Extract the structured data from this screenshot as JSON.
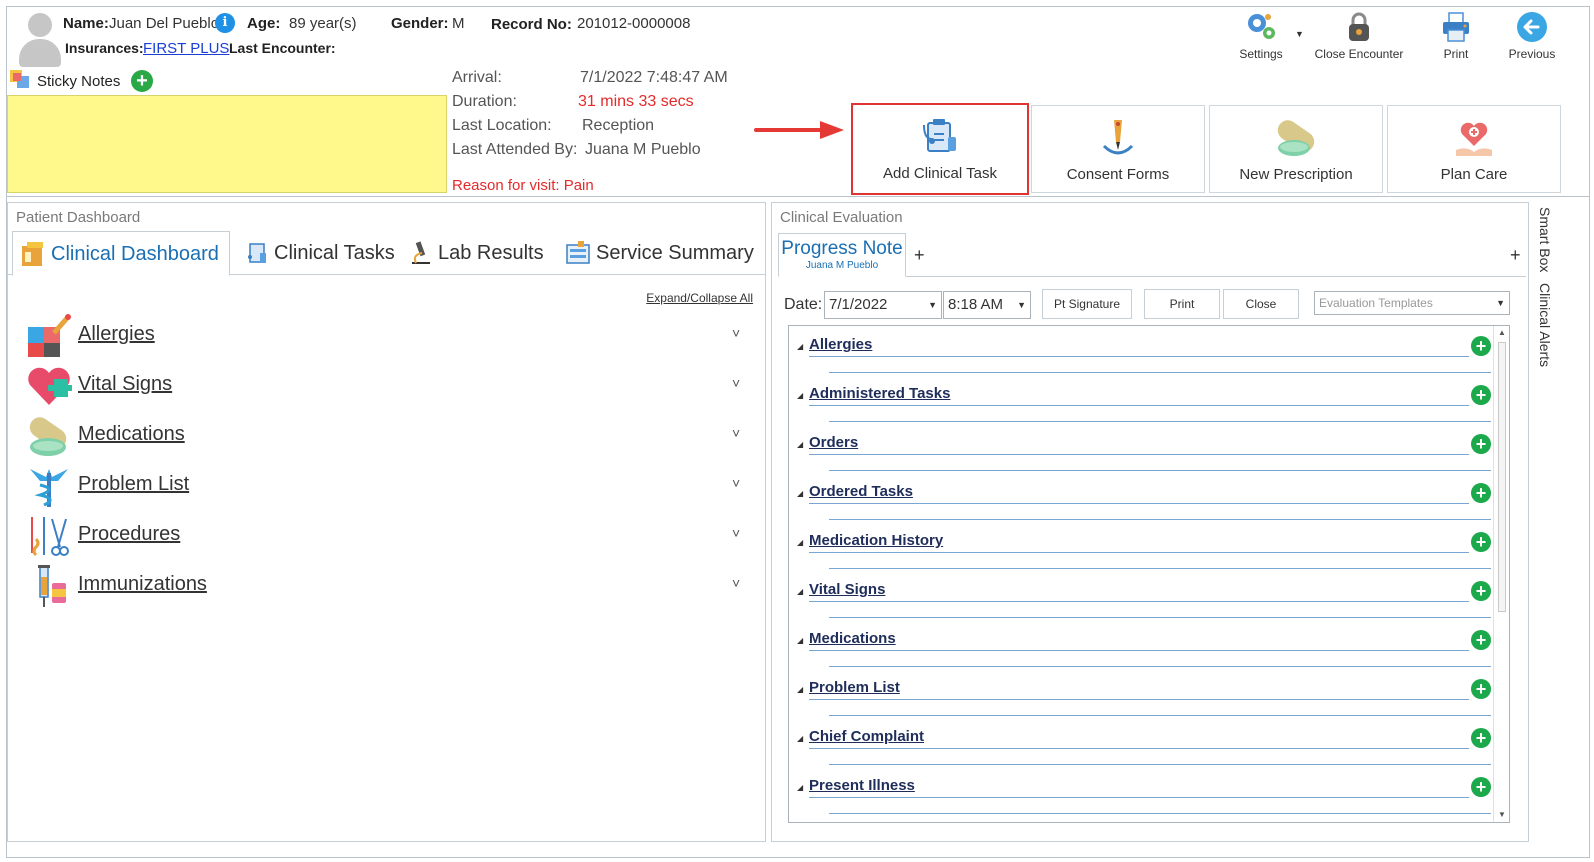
{
  "patient": {
    "name_label": "Name:",
    "name": "Juan Del Pueblo",
    "age_label": "Age:",
    "age": "89 year(s)",
    "gender_label": "Gender:",
    "gender": "M",
    "record_label": "Record No:",
    "record": "201012-0000008",
    "insurances_label": "Insurances:",
    "insurance": "FIRST PLUS",
    "last_encounter_label": "Last Encounter:"
  },
  "toolbar": {
    "settings": "Settings",
    "close_encounter": "Close Encounter",
    "print": "Print",
    "previous": "Previous"
  },
  "sticky": {
    "label": "Sticky Notes",
    "add": "+"
  },
  "encounter": {
    "arrival_label": "Arrival:",
    "arrival": "7/1/2022 7:48:47 AM",
    "duration_label": "Duration:",
    "duration": "31 mins 33 secs",
    "location_label": "Last Location:",
    "location": "Reception",
    "attended_label": "Last Attended By:",
    "attended": "Juana M Pueblo",
    "reason": "Reason for visit: Pain"
  },
  "actions": {
    "add_task": "Add Clinical Task",
    "consent": "Consent Forms",
    "prescription": "New Prescription",
    "plan": "Plan Care"
  },
  "dashboard": {
    "title": "Patient Dashboard",
    "tabs": [
      "Clinical Dashboard",
      "Clinical Tasks",
      "Lab Results",
      "Service Summary"
    ],
    "expand": "Expand/Collapse All",
    "items": [
      "Allergies",
      "Vital Signs",
      "Medications",
      "Problem List",
      "Procedures",
      "Immunizations"
    ],
    "chevron": "˅"
  },
  "evaluation": {
    "title": "Clinical Evaluation",
    "tab_title": "Progress Note",
    "tab_sub": "Juana M Pueblo",
    "plus": "+",
    "date_label": "Date:",
    "date": "7/1/2022",
    "time": "8:18 AM",
    "pt_signature": "Pt Signature",
    "print": "Print",
    "close": "Close",
    "templates_placeholder": "Evaluation Templates",
    "sections": [
      "Allergies",
      "Administered Tasks",
      "Orders",
      "Ordered Tasks",
      "Medication History",
      "Vital Signs",
      "Medications",
      "Problem List",
      "Chief Complaint",
      "Present Illness"
    ],
    "add_symbol": "+",
    "tri": "◢"
  },
  "side_tabs": {
    "smart_box": "Smart Box",
    "clinical_alerts": "Clinical Alerts"
  },
  "colors": {
    "accent_blue": "#1a6fb3",
    "add_green": "#1ba94c",
    "sticky_yellow": "#fff98b",
    "alert_red": "#e42a2a"
  }
}
